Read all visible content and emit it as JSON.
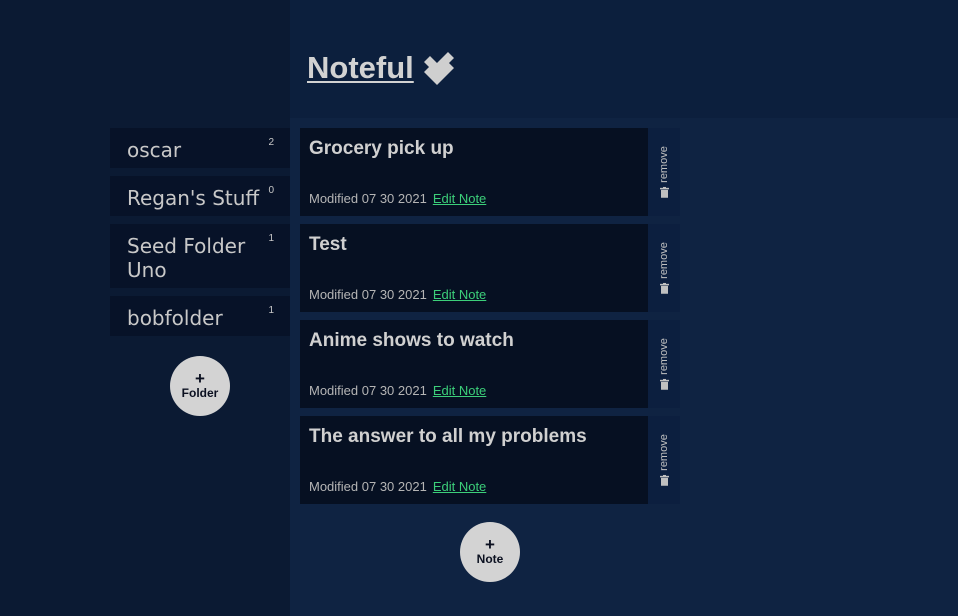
{
  "app": {
    "title": "Noteful"
  },
  "folders": [
    {
      "name": "oscar",
      "count": "2"
    },
    {
      "name": "Regan's Stuff",
      "count": "0"
    },
    {
      "name": "Seed Folder Uno",
      "count": "1"
    },
    {
      "name": "bobfolder",
      "count": "1"
    }
  ],
  "add_folder": {
    "plus": "+",
    "label": "Folder"
  },
  "notes": [
    {
      "title": "Grocery pick up",
      "modified": "Modified 07 30 2021",
      "edit": "Edit Note",
      "remove": "remove"
    },
    {
      "title": "Test",
      "modified": "Modified 07 30 2021",
      "edit": "Edit Note",
      "remove": "remove"
    },
    {
      "title": "Anime shows to watch",
      "modified": "Modified 07 30 2021",
      "edit": "Edit Note",
      "remove": "remove"
    },
    {
      "title": "The answer to all my problems",
      "modified": "Modified 07 30 2021",
      "edit": "Edit Note",
      "remove": "remove"
    }
  ],
  "add_note": {
    "plus": "+",
    "label": "Note"
  },
  "colors": {
    "accent_link": "#3ccf7a",
    "button_bg": "#d3d3d3",
    "text": "#d0d0d0"
  },
  "icons": {
    "title_icon": "double-check-icon",
    "remove_icon": "trash-icon"
  }
}
